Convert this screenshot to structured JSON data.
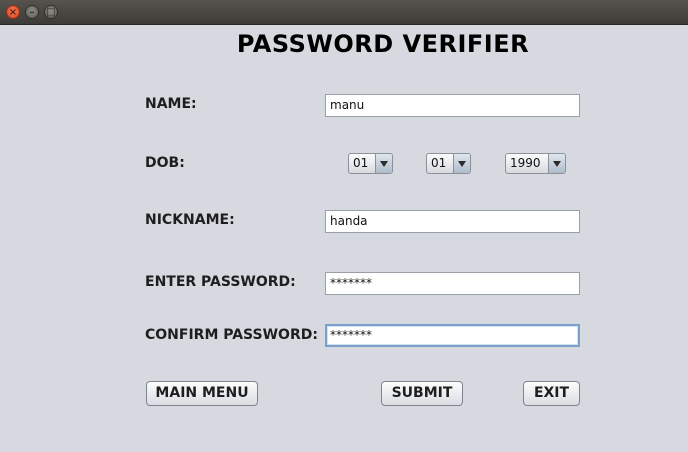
{
  "window": {
    "close_symbol": "×",
    "minimize_symbol": "–",
    "maximize_symbol": "□"
  },
  "heading": "PASSWORD VERIFIER",
  "form": {
    "name": {
      "label": "NAME:",
      "value": "manu"
    },
    "dob": {
      "label": "DOB:",
      "day": "01",
      "month": "01",
      "year": "1990"
    },
    "nickname": {
      "label": "NICKNAME:",
      "value": "handa"
    },
    "password": {
      "label": "ENTER PASSWORD:",
      "value": "*******"
    },
    "confirm_password": {
      "label": "CONFIRM PASSWORD:",
      "value": "*******"
    }
  },
  "buttons": {
    "main_menu": "MAIN MENU",
    "submit": "SUBMIT",
    "exit": "EXIT"
  }
}
